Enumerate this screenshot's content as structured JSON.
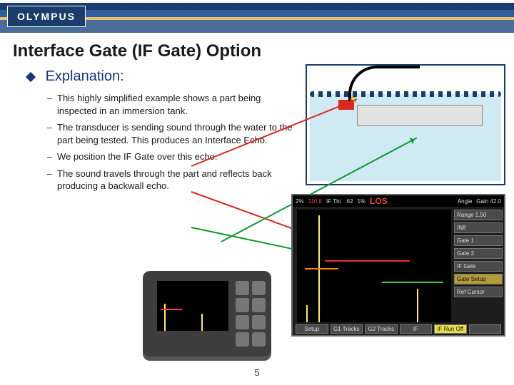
{
  "brand": "OLYMPUS",
  "title": "Interface Gate (IF Gate) Option",
  "heading": "Explanation:",
  "bullets": [
    "This highly simplified example shows a part being inspected in an immersion tank.",
    "The transducer is sending sound through the water to the part being tested.  This produces an Interface Echo.",
    "We position the IF Gate over this echo.",
    "The sound travels through the part and reflects back producing a backwall echo."
  ],
  "page_number": "5",
  "instrument": {
    "topbar": {
      "pct_left": "2%",
      "range_red": "110.8",
      "label": "IF Thi",
      "val": ".62",
      "pct_right": "1%",
      "los": "LOS",
      "angle": "Angle",
      "gain": "Gain   42.0"
    },
    "side_buttons": [
      "Range  1.50",
      "IN8",
      "Gate 1",
      "Gate 2",
      "IF Gate",
      "Gate Setup",
      "Ref Cursor"
    ],
    "bottom_buttons": [
      "Setup",
      "G1 Tracks",
      "G2 Tracks",
      "IF",
      "IF Run Off",
      ""
    ]
  }
}
